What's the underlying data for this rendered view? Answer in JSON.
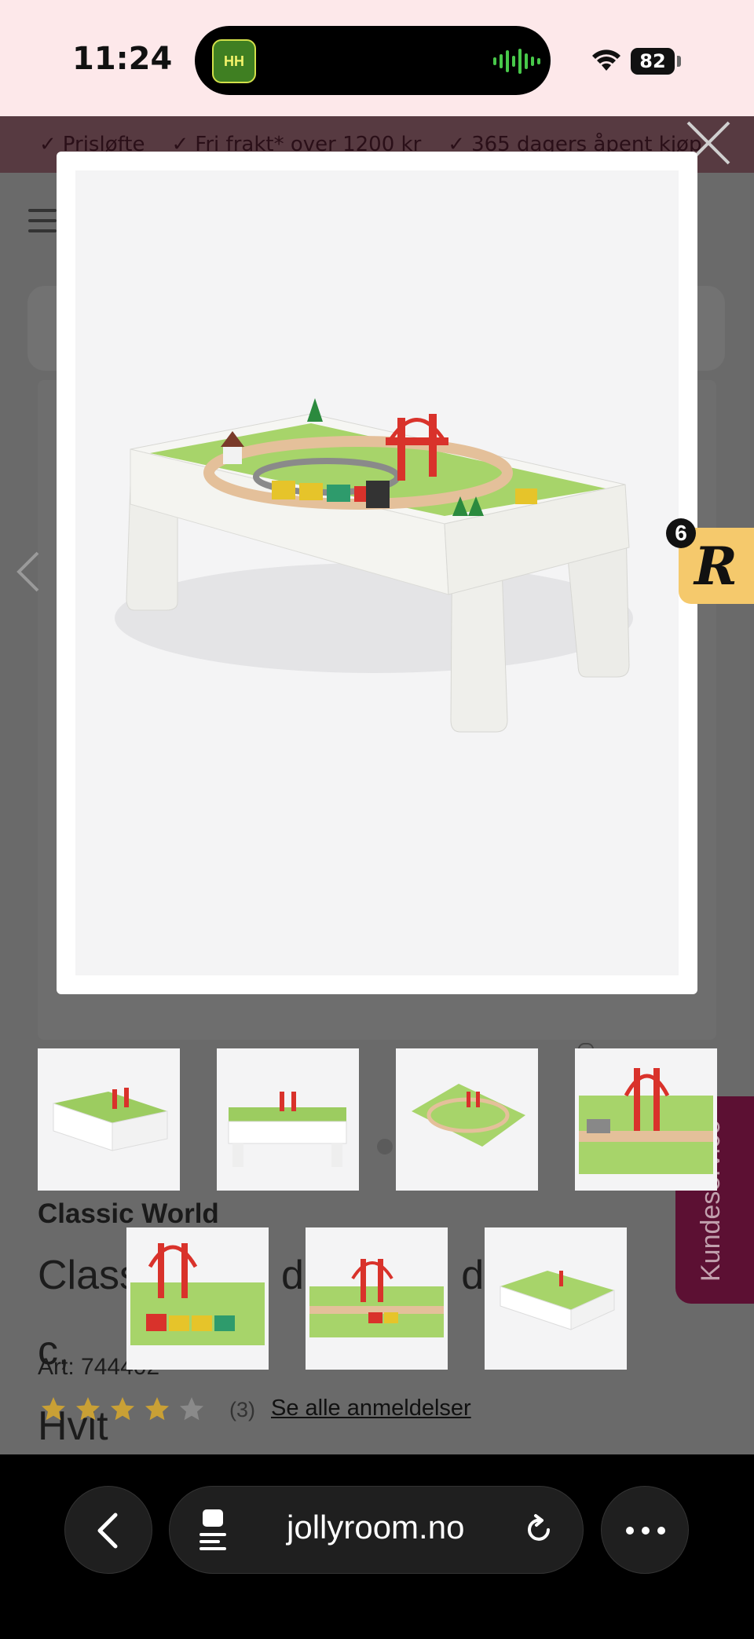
{
  "status": {
    "time": "11:24",
    "battery": "82",
    "island_app_label": "HH"
  },
  "banner": {
    "items": [
      "Prisløfte",
      "Fri frakt* over 1200 kr",
      "365 dagers åpent kjøp"
    ]
  },
  "rating_widget": {
    "count": "6",
    "letter": "R"
  },
  "customer_service": {
    "label": "Kundeservice"
  },
  "product": {
    "brand": "Classic World",
    "title_line1_start": "Class",
    "title_line1_mid": "d T",
    "title_line1_mid2": "d 6",
    "title_line1_end": "c,",
    "title_line2": "Hvit",
    "art_label": "Art:",
    "art_number": "744402",
    "rating": 4,
    "review_count": "(3)",
    "reviews_link": "Se alle anmeldelser"
  },
  "icons": {
    "close": "close-icon",
    "prev": "chevron-left-icon",
    "menu": "hamburger-icon"
  },
  "browser": {
    "url": "jollyroom.no"
  },
  "colors": {
    "accent": "#5c1033",
    "star": "#d9a91f",
    "banner_bg": "#fde8ea"
  }
}
